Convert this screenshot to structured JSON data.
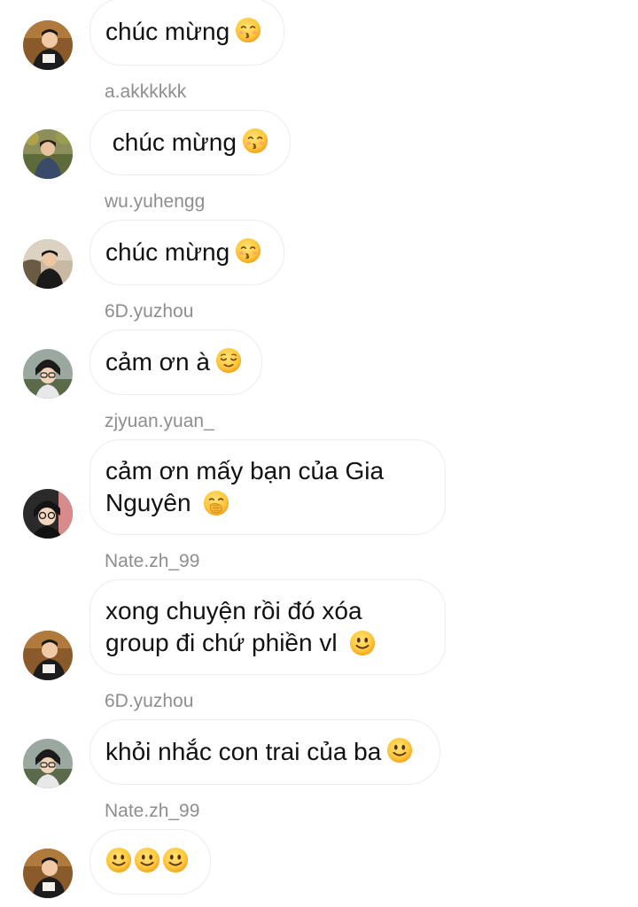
{
  "messages": [
    {
      "sender": "",
      "avatar": "avatar-a",
      "text": "chúc mừng",
      "emojis": [
        "kissing-smiling-eyes"
      ]
    },
    {
      "sender": "a.akkkkkk",
      "avatar": "avatar-b",
      "text": " chúc mừng",
      "emojis": [
        "kissing-smiling-eyes"
      ]
    },
    {
      "sender": "wu.yuhengg",
      "avatar": "avatar-c",
      "text": "chúc mừng",
      "emojis": [
        "kissing-smiling-eyes"
      ]
    },
    {
      "sender": "6D.yuzhou",
      "avatar": "avatar-d",
      "text": "cảm ơn à",
      "emojis": [
        "relieved-face"
      ]
    },
    {
      "sender": "zjyuan.yuan_",
      "avatar": "avatar-e",
      "text_line1": "cảm ơn mấy bạn của Gia",
      "text_line2": "Nguyên",
      "emojis": [
        "face-hand-over-mouth"
      ]
    },
    {
      "sender": "Nate.zh_99",
      "avatar": "avatar-a",
      "text_line1": "xong chuyện rồi đó xóa",
      "text_line2": "group đi chứ phiền vl",
      "emojis": [
        "slightly-smiling-face"
      ]
    },
    {
      "sender": "6D.yuzhou",
      "avatar": "avatar-d",
      "text": "khỏi nhắc con trai của ba",
      "emojis": [
        "slightly-smiling-face"
      ]
    },
    {
      "sender": "Nate.zh_99",
      "avatar": "avatar-a",
      "text": "",
      "emojis": [
        "slightly-smiling-face",
        "slightly-smiling-face",
        "slightly-smiling-face"
      ]
    }
  ],
  "colors": {
    "bubble_border": "#ececec",
    "sender_text": "#8e8e8e",
    "message_text": "#111111",
    "emoji_yellow": "#ffcc33"
  }
}
